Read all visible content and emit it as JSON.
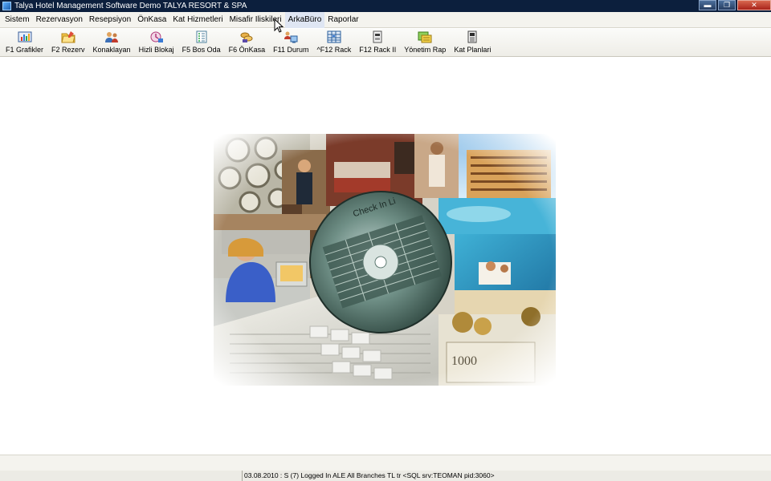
{
  "window": {
    "title": "Talya Hotel Management Software Demo TALYA RESORT & SPA",
    "buttons": {
      "minimize": "▬",
      "restore": "❐",
      "close": "✕"
    }
  },
  "menu": [
    {
      "label": "Sistem"
    },
    {
      "label": "Rezervasyon"
    },
    {
      "label": "Resepsiyon"
    },
    {
      "label": "ÖnKasa"
    },
    {
      "label": "Kat Hizmetleri"
    },
    {
      "label": "Misafir Iliskileri"
    },
    {
      "label": "ArkaBüro"
    },
    {
      "label": "Raporlar"
    }
  ],
  "toolbar": [
    {
      "label": "F1 Grafikler",
      "icon": "chart-icon"
    },
    {
      "label": "F2 Rezerv",
      "icon": "folder-icon"
    },
    {
      "label": "Konaklayan",
      "icon": "guests-icon"
    },
    {
      "label": "Hizli Blokaj",
      "icon": "block-icon"
    },
    {
      "label": "F5 Bos Oda",
      "icon": "checklist-icon"
    },
    {
      "label": "F6 ÖnKasa",
      "icon": "cash-icon"
    },
    {
      "label": "F11 Durum",
      "icon": "status-icon"
    },
    {
      "label": "^F12 Rack",
      "icon": "rack-icon"
    },
    {
      "label": "F12 Rack II",
      "icon": "rack2-icon"
    },
    {
      "label": "Yönetim Rap",
      "icon": "report-icon"
    },
    {
      "label": "Kat Planlari",
      "icon": "floorplan-icon"
    }
  ],
  "splash": {
    "disc_text": "Check In Li"
  },
  "status": {
    "text": "03.08.2010 : S (7) Logged In ALE All Branches  TL tr  <SQL srv:TEOMAN pid:3060>"
  },
  "colors": {
    "titlebar": "#0c1f3d",
    "menubar": "#f4f3ee",
    "workspace": "#ffffff"
  }
}
